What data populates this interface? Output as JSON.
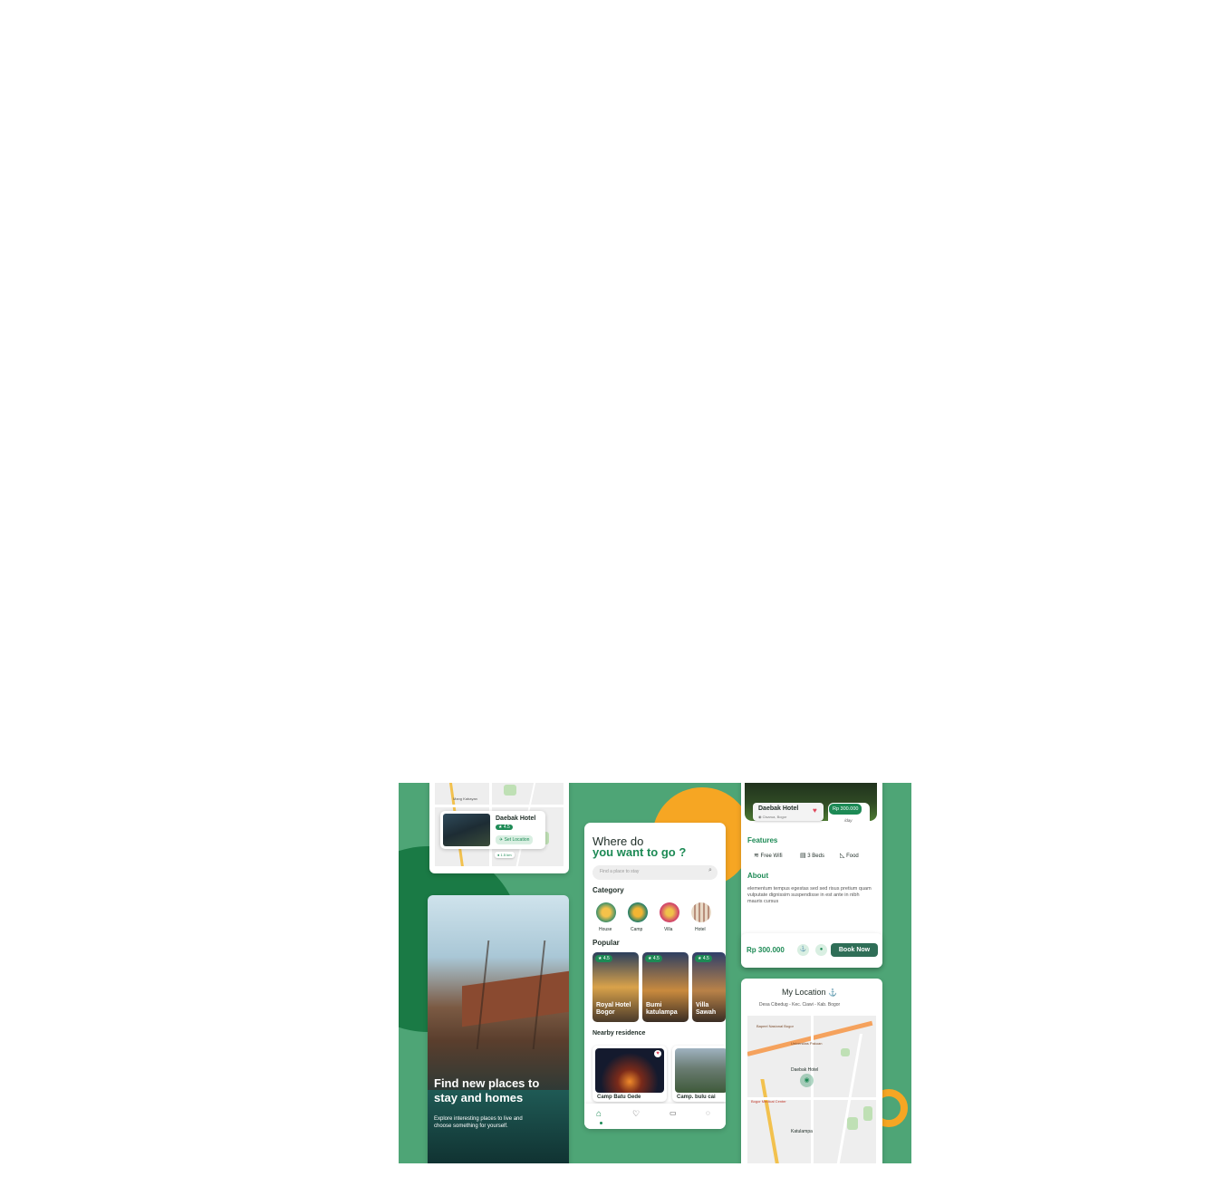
{
  "colors": {
    "brand_green": "#1d8a55",
    "banner_bg": "#4ea576",
    "dark_green": "#1a7a45",
    "accent_orange": "#f6a623",
    "button_dark": "#2f6e57"
  },
  "map_card": {
    "map_label": "Mang Kabayan",
    "hotel_name": "Daebak Hotel",
    "rating": "4.5",
    "distance": "1.5 km",
    "set_location": "Set Location"
  },
  "onboarding": {
    "title": "Find new places to stay and homes",
    "subtitle": "Explore interesting places to live and choose something for yourself."
  },
  "home": {
    "title_line1": "Where do",
    "title_line2": "you want to go ?",
    "search_placeholder": "Find a place to stay",
    "category_heading": "Category",
    "categories": [
      {
        "label": "House",
        "icon": "house-icon"
      },
      {
        "label": "Camp",
        "icon": "camp-icon"
      },
      {
        "label": "Villa",
        "icon": "villa-icon"
      },
      {
        "label": "Hotel",
        "icon": "hotel-icon"
      }
    ],
    "popular_heading": "Popular",
    "popular": [
      {
        "name": "Royal Hotel Bogor",
        "rating": "4.5"
      },
      {
        "name": "Bumi katulampa",
        "rating": "4.5"
      },
      {
        "name": "Villa Sawah",
        "rating": "4.5"
      }
    ],
    "nearby_heading": "Nearby residence",
    "nearby": [
      {
        "name": "Camp Batu Gede"
      },
      {
        "name": "Camp. bulu cai"
      }
    ],
    "nav": [
      "home-icon",
      "heart-icon",
      "calendar-icon",
      "chat-icon"
    ]
  },
  "detail": {
    "hotel_name": "Daebak Hotel",
    "location": "Cisarua, Bogor",
    "price_badge": "Rp 300.000",
    "price_badge_unit": "/day",
    "features_heading": "Features",
    "features": [
      {
        "label": "Free Wifi",
        "icon": "wifi-icon"
      },
      {
        "label": "3 Beds",
        "icon": "bed-icon"
      },
      {
        "label": "Food",
        "icon": "food-icon"
      }
    ],
    "about_heading": "About",
    "about_text": "elementum tempus egestas sed sed risus pretium quam vulputate dignissim suspendisse in est ante in nibh mauris cursus",
    "price": "Rp 300.000",
    "book_now": "Book Now"
  },
  "my_location": {
    "title": "My Location",
    "address": "Desa Cibedug - Kec. Ciawi - Kab. Bogor",
    "map_label_1": "Bapeel Nasional Bogor",
    "map_label_2": "Universitas Pakuan",
    "map_label_3": "Daebak Hotel",
    "map_label_4": "Bogor Medical Center",
    "map_label_5": "Katulampa"
  }
}
